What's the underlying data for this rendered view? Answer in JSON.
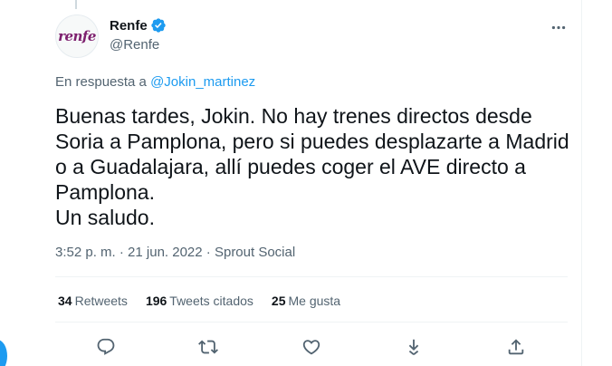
{
  "author": {
    "avatar_text": "renfe",
    "display_name": "Renfe",
    "handle": "@Renfe"
  },
  "reply": {
    "prefix": "En respuesta a",
    "mention": "@Jokin_martinez"
  },
  "tweet": {
    "text": "Buenas tardes, Jokin. No hay trenes directos desde Soria a Pamplona, pero si puedes desplazarte a Madrid o a Guadalajara, allí puedes coger el AVE directo a Pamplona.\nUn saludo.",
    "time": "3:52 p. m.",
    "date": "21 jun. 2022",
    "source": "Sprout Social"
  },
  "stats": {
    "retweets_count": "34",
    "retweets_label": "Retweets",
    "quotes_count": "196",
    "quotes_label": "Tweets citados",
    "likes_count": "25",
    "likes_label": "Me gusta"
  },
  "colors": {
    "link": "#1d9bf0",
    "secondary_text": "#536471",
    "brand": "#7d1f6e"
  },
  "icons": [
    "verified-icon",
    "more-icon",
    "reply-icon",
    "retweet-icon",
    "like-icon",
    "bookmark-icon",
    "share-icon"
  ]
}
